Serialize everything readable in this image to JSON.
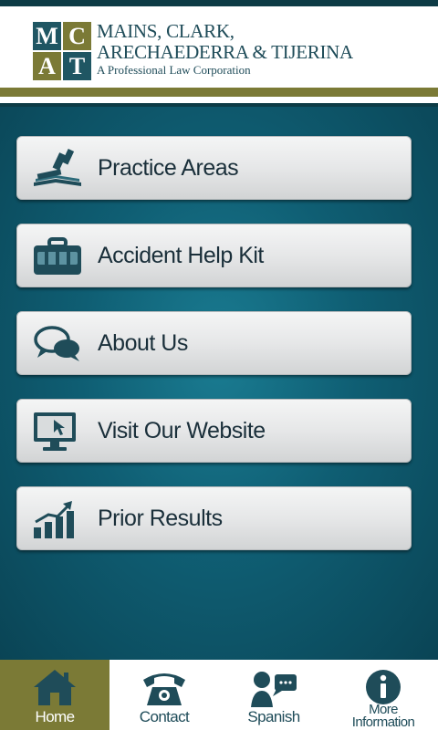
{
  "header": {
    "logo_letters": [
      "M",
      "C",
      "A",
      "T"
    ],
    "firm_name_line1": "MAINS, CLARK,",
    "firm_name_line2": "ARECHAEDERRA & TIJERINA",
    "tagline": "A Professional Law Corporation"
  },
  "menu": {
    "items": [
      {
        "label": "Practice Areas",
        "icon": "gavel-book-icon"
      },
      {
        "label": "Accident Help Kit",
        "icon": "briefcase-icon"
      },
      {
        "label": "About Us",
        "icon": "chat-bubbles-icon"
      },
      {
        "label": "Visit Our Website",
        "icon": "monitor-cursor-icon"
      },
      {
        "label": "Prior Results",
        "icon": "bar-chart-arrow-icon"
      }
    ]
  },
  "tabbar": {
    "tabs": [
      {
        "label": "Home",
        "icon": "house-icon",
        "active": true
      },
      {
        "label": "Contact",
        "icon": "telephone-icon",
        "active": false
      },
      {
        "label": "Spanish",
        "icon": "speaking-person-icon",
        "active": false
      },
      {
        "label_line1": "More",
        "label_line2": "Information",
        "icon": "info-icon",
        "active": false
      }
    ]
  },
  "colors": {
    "brand_teal": "#1f5663",
    "brand_olive": "#7b7a36",
    "background_teal": "#0f5e73",
    "icon_dark": "#1f4c59"
  }
}
